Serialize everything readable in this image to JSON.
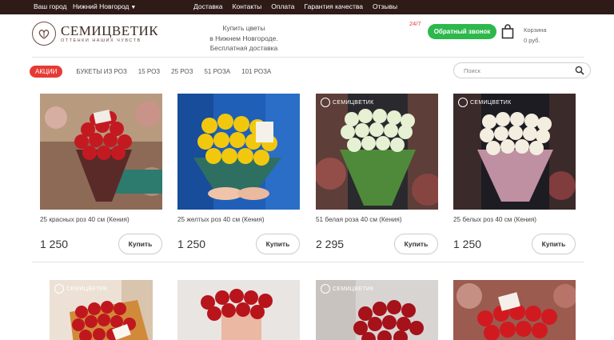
{
  "topbar": {
    "city_label": "Ваш город",
    "city": "Нижний Новгород",
    "nav": [
      "Доставка",
      "Контакты",
      "Оплата",
      "Гарантия качества",
      "Отзывы"
    ]
  },
  "header": {
    "logo_name": "СЕМИЦВЕТИК",
    "logo_tagline": "ОТТЕНКИ НАШИХ ЧУВСТВ",
    "info_line1": "Купить цветы",
    "info_line2": "в Нижнем Новгороде.",
    "info_line3": "Бесплатная доставка",
    "hours": "24/7",
    "callback_label": "Обратный звонок",
    "cart_label": "Корзина",
    "cart_total": "0 руб."
  },
  "categories": [
    "Акции",
    "Букеты из роз",
    "15 роз",
    "25 роз",
    "51 роза",
    "101 роза"
  ],
  "search": {
    "placeholder": "Поиск"
  },
  "watermark_text": "СЕМИЦВЕТИК",
  "products": [
    {
      "title": "25 красных роз 40 см (Кения)",
      "price": "1 250",
      "buy_label": "Купить"
    },
    {
      "title": "25 желтых роз 40 см (Кения)",
      "price": "1 250",
      "buy_label": "Купить"
    },
    {
      "title": "51 белая роза 40 см (Кения)",
      "price": "2 295",
      "buy_label": "Купить"
    },
    {
      "title": "25 белых роз 40 см (Кения)",
      "price": "1 250",
      "buy_label": "Купить"
    }
  ],
  "colors": {
    "topbar": "#2e1a17",
    "accent_red": "#e63a35",
    "callback_green": "#2db84c"
  }
}
